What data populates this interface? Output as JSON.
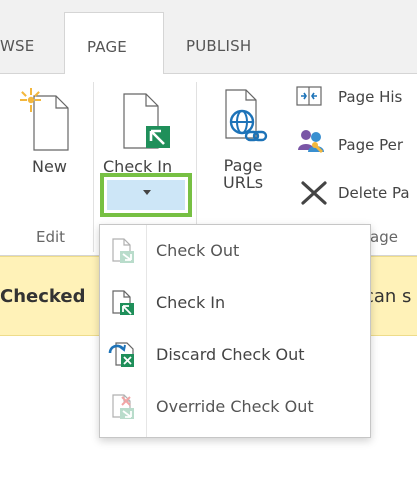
{
  "tabs": [
    {
      "label": "WSE"
    },
    {
      "label": "PAGE"
    },
    {
      "label": "PUBLISH"
    }
  ],
  "ribbon": {
    "new_label": "New",
    "check_in_label": "Check In",
    "page_urls_label_line1": "Page",
    "page_urls_label_line2": "URLs",
    "page_history_label": "Page His",
    "page_permissions_label": "Page Per",
    "delete_page_label": "Delete Pa",
    "groups": {
      "edit": "Edit",
      "manage_partial": "age"
    }
  },
  "status_bar": {
    "left_text": "Checked",
    "right_text": "can s"
  },
  "menu": {
    "items": [
      {
        "label": "Check Out",
        "icon": "check-out-icon",
        "enabled": false
      },
      {
        "label": "Check In",
        "icon": "check-in-icon",
        "enabled": true
      },
      {
        "label": "Discard Check Out",
        "icon": "discard-check-out-icon",
        "enabled": true
      },
      {
        "label": "Override Check Out",
        "icon": "override-check-out-icon",
        "enabled": false
      }
    ]
  },
  "colors": {
    "accent_green": "#77c043",
    "highlight_blue": "#cde6f7",
    "status_yellow": "#fff2b8",
    "icon_green": "#2e8b57",
    "icon_blue": "#1d73b8",
    "disabled_text": "#9aa0a6"
  }
}
